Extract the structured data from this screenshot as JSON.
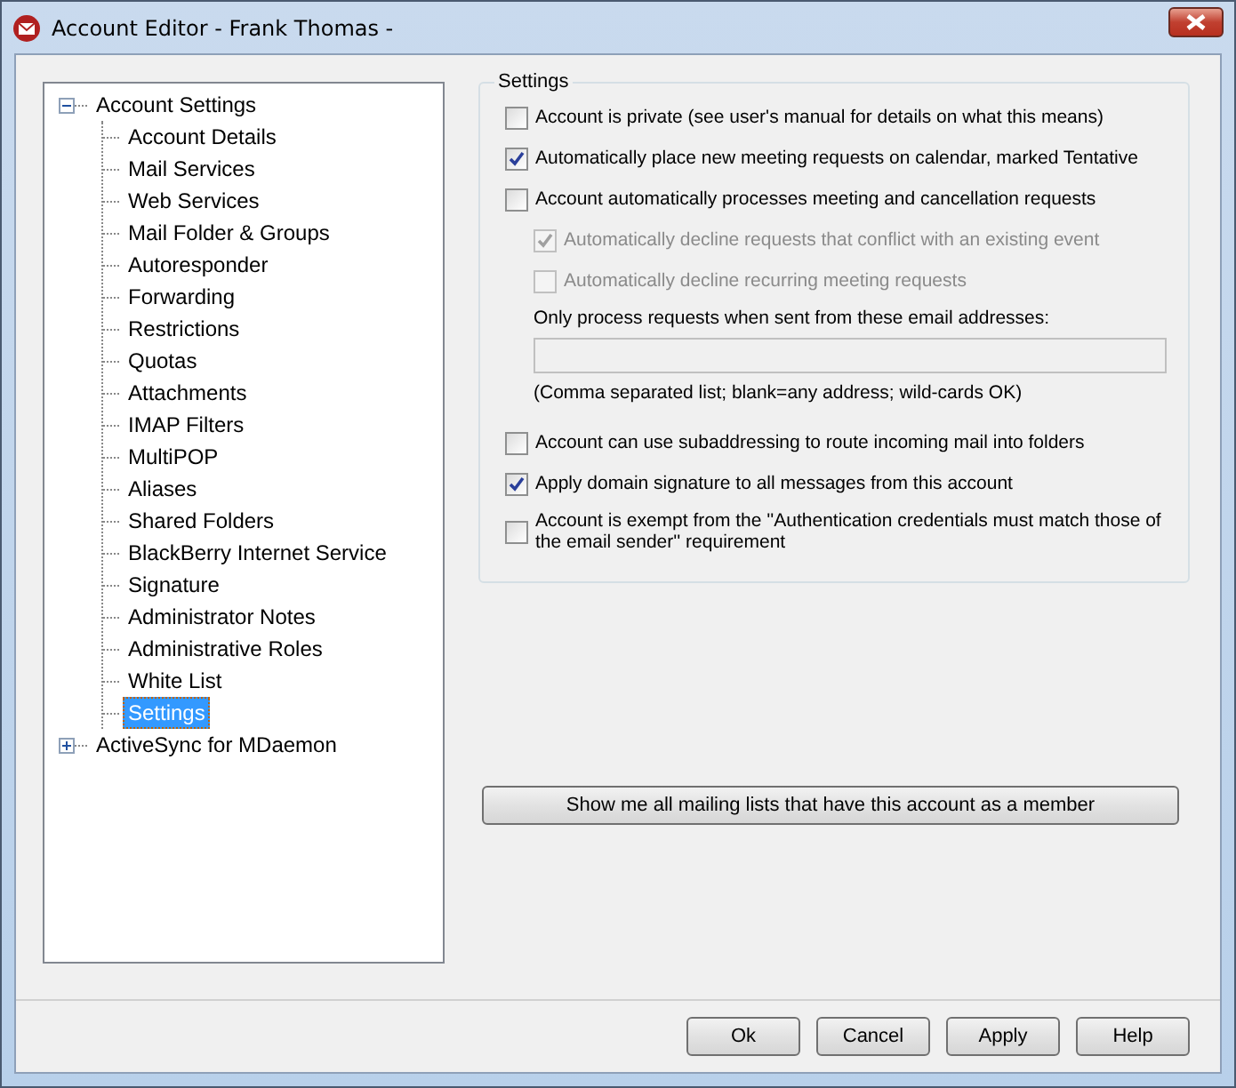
{
  "window": {
    "title": "Account Editor - Frank Thomas -"
  },
  "tree": [
    {
      "label": "Account Settings",
      "expanded": true,
      "selected": false,
      "children": [
        {
          "label": "Account Details",
          "selected": false
        },
        {
          "label": "Mail Services",
          "selected": false
        },
        {
          "label": "Web Services",
          "selected": false
        },
        {
          "label": "Mail Folder & Groups",
          "selected": false
        },
        {
          "label": "Autoresponder",
          "selected": false
        },
        {
          "label": "Forwarding",
          "selected": false
        },
        {
          "label": "Restrictions",
          "selected": false
        },
        {
          "label": "Quotas",
          "selected": false
        },
        {
          "label": "Attachments",
          "selected": false
        },
        {
          "label": "IMAP Filters",
          "selected": false
        },
        {
          "label": "MultiPOP",
          "selected": false
        },
        {
          "label": "Aliases",
          "selected": false
        },
        {
          "label": "Shared Folders",
          "selected": false
        },
        {
          "label": "BlackBerry Internet Service",
          "selected": false
        },
        {
          "label": "Signature",
          "selected": false
        },
        {
          "label": "Administrator Notes",
          "selected": false
        },
        {
          "label": "Administrative Roles",
          "selected": false
        },
        {
          "label": "White List",
          "selected": false
        },
        {
          "label": "Settings",
          "selected": true
        }
      ]
    },
    {
      "label": "ActiveSync for MDaemon",
      "expanded": false,
      "selected": false
    }
  ],
  "settings": {
    "title": "Settings",
    "options": [
      {
        "kind": "checkbox",
        "label": "Account is private (see user's manual for details on what this means)",
        "checked": false,
        "disabled": false
      },
      {
        "kind": "checkbox",
        "label": "Automatically place new meeting requests on calendar, marked Tentative",
        "checked": true,
        "disabled": false
      },
      {
        "kind": "checkbox",
        "label": "Account automatically processes meeting and cancellation requests",
        "checked": false,
        "disabled": false,
        "children": [
          {
            "kind": "checkbox",
            "label": "Automatically decline requests that conflict with an existing event",
            "checked": true,
            "disabled": true
          },
          {
            "kind": "checkbox",
            "label": "Automatically decline recurring meeting requests",
            "checked": false,
            "disabled": true
          },
          {
            "kind": "label",
            "label": "Only process requests when sent from these email addresses:"
          },
          {
            "kind": "field"
          },
          {
            "kind": "note",
            "label": "(Comma separated list; blank=any address; wild-cards OK)"
          }
        ]
      },
      {
        "kind": "checkbox",
        "label": "Account can use subaddressing to route incoming mail into folders",
        "checked": false,
        "disabled": false
      },
      {
        "kind": "checkbox",
        "label": "Apply domain signature to all messages from this account",
        "checked": true,
        "disabled": false
      },
      {
        "kind": "checkbox",
        "label": "Account is exempt from the ''Authentication credentials must match those of the email sender'' requirement",
        "checked": false,
        "disabled": false
      }
    ]
  },
  "mailing_lists_button": "Show me all mailing lists that have this account as a member",
  "buttons": [
    "Ok",
    "Cancel",
    "Apply",
    "Help"
  ]
}
